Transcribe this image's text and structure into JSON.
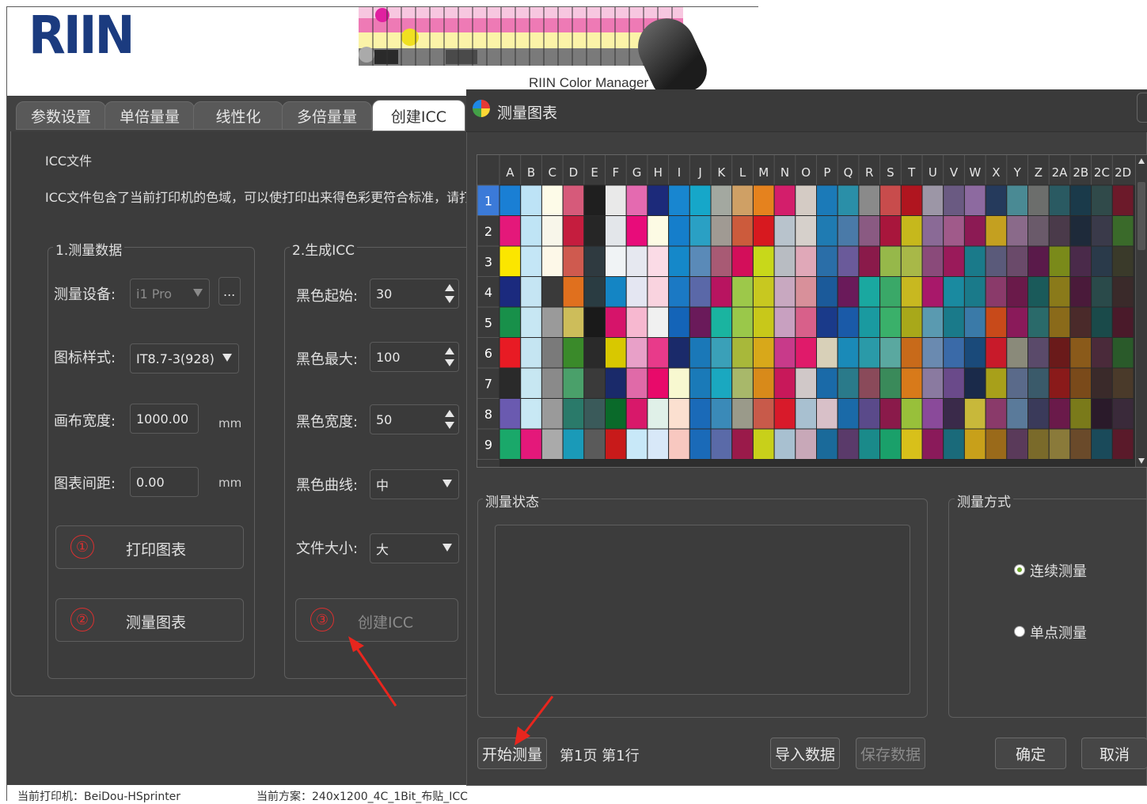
{
  "app": {
    "logo_text": "RIIN",
    "banner_caption": "RIIN Color Manager",
    "tabs": [
      "参数设置",
      "单倍量量",
      "线性化",
      "多倍量量",
      "创建ICC"
    ],
    "active_tab": "创建ICC"
  },
  "icc": {
    "section_title": "ICC文件",
    "description": "ICC文件包含了当前打印机的色域，可以使打印出来得色彩更符合标准，请打印图表",
    "group1": {
      "title": "1.测量数据",
      "device_label": "测量设备:",
      "device_value": "i1 Pro",
      "device_more": "...",
      "chart_style_label": "图标样式:",
      "chart_style_value": "IT8.7-3(928)",
      "canvas_width_label": "画布宽度:",
      "canvas_width_value": "1000.00",
      "chart_gap_label": "图表间距:",
      "chart_gap_value": "0.00",
      "unit_mm": "mm",
      "print_button": {
        "number": "①",
        "label": "打印图表"
      },
      "measure_button": {
        "number": "②",
        "label": "测量图表"
      }
    },
    "group2": {
      "title": "2.生成ICC",
      "black_start_label": "黑色起始:",
      "black_start_value": "30",
      "black_max_label": "黑色最大:",
      "black_max_value": "100",
      "black_width_label": "黑色宽度:",
      "black_width_value": "50",
      "black_curve_label": "黑色曲线:",
      "black_curve_value": "中",
      "file_size_label": "文件大小:",
      "file_size_value": "大",
      "create_button": {
        "number": "③",
        "label": "创建ICC"
      }
    }
  },
  "statusbar": {
    "printer": "当前打印机：BeiDou-HSprinter",
    "scheme": "当前方案：240x1200_4C_1Bit_布贴_ICC"
  },
  "dialog": {
    "title": "测量图表",
    "columns": [
      "A",
      "B",
      "C",
      "D",
      "E",
      "F",
      "G",
      "H",
      "I",
      "J",
      "K",
      "L",
      "M",
      "N",
      "O",
      "P",
      "Q",
      "R",
      "S",
      "T",
      "U",
      "V",
      "W",
      "X",
      "Y",
      "Z",
      "2A",
      "2B",
      "2C",
      "2D"
    ],
    "rows": [
      "1",
      "2",
      "3",
      "4",
      "5",
      "6",
      "7",
      "8",
      "9"
    ],
    "patch_colors": [
      [
        "#1a7fd4",
        "#bde3f6",
        "#fdfbe8",
        "#d65a7a",
        "#1f1f1f",
        "#e9e9e9",
        "#e46ab0",
        "#1c2a7a",
        "#1886d0",
        "#16a7c9",
        "#a3a8a0",
        "#cfa065",
        "#e5821e",
        "#d31e6b",
        "#d4cbc4",
        "#1b7ab8",
        "#2a8fa8",
        "#8a8a8a",
        "#c84c4c",
        "#b0151f",
        "#9c96a6",
        "#6a5a82",
        "#8d6aa0",
        "#253a5c",
        "#4a8a94",
        "#6c6e6c",
        "#2a5a62",
        "#1a3a4a",
        "#304a4a",
        "#6c1a2a"
      ],
      [
        "#e4187a",
        "#bfe4f5",
        "#f8f6ea",
        "#c51d3e",
        "#262626",
        "#e3e6ea",
        "#e80c7a",
        "#fdfbe4",
        "#157ecb",
        "#2aa0c4",
        "#a09a93",
        "#cc5b3c",
        "#d7191f",
        "#b8c3cc",
        "#d6d0cb",
        "#1f7bb2",
        "#4a7aa8",
        "#8a5a82",
        "#a8163c",
        "#c6b81c",
        "#8a6a96",
        "#a05a8a",
        "#8c1a54",
        "#c4a020",
        "#8a6a8a",
        "#6a5a6a",
        "#4a3a4a",
        "#1e2a3a",
        "#3a3a4a",
        "#3a6a2a"
      ],
      [
        "#fbe600",
        "#c4e6f6",
        "#fdf8e8",
        "#cf5a4f",
        "#2f3a40",
        "#f0f3f5",
        "#e6e8f0",
        "#fbdbe6",
        "#1588c9",
        "#5a8ab8",
        "#a85a74",
        "#d30e5a",
        "#c8d81a",
        "#b8bcc2",
        "#e0a8b8",
        "#2a6ea8",
        "#6a5a9a",
        "#8a1a4a",
        "#96b84a",
        "#a8b848",
        "#8a4a7a",
        "#9a1a5a",
        "#1a7a8a",
        "#5a5a7a",
        "#6a4a6a",
        "#5a1a4a",
        "#7a8a1a",
        "#4a2a4a",
        "#2a3a4a",
        "#3a3a2a"
      ],
      [
        "#1b2a7e",
        "#c5e5f3",
        "#3a3a3a",
        "#e0701e",
        "#2a3c42",
        "#1485c4",
        "#e4e6f2",
        "#f9d3df",
        "#1b79c4",
        "#5a68a8",
        "#b81460",
        "#9dc84a",
        "#c8c820",
        "#c8a8c0",
        "#d8909a",
        "#1b5a9a",
        "#6a1a5a",
        "#1aa8a0",
        "#3aa868",
        "#c8b820",
        "#a8186a",
        "#1a8aa0",
        "#1a7a8a",
        "#8a3a6a",
        "#6a1a4a",
        "#1a5a5a",
        "#8a7a1a",
        "#4a1a3a",
        "#2a4a4a",
        "#3a2a2a"
      ],
      [
        "#18904a",
        "#c7e7f3",
        "#9a9a9a",
        "#cdbd5a",
        "#1a1a1a",
        "#d6146a",
        "#f7b8d0",
        "#f0f0f0",
        "#1464b8",
        "#6a1a5a",
        "#1ab4a0",
        "#9ac84a",
        "#c8c81a",
        "#c8a0c0",
        "#d8608a",
        "#1a3a8a",
        "#1a5aa8",
        "#1a9aa0",
        "#3ab06a",
        "#a8a81a",
        "#5a9ab0",
        "#1a7a8a",
        "#3a7aa8",
        "#c84a1a",
        "#8a1a5a",
        "#2a6a6a",
        "#8a6a1a",
        "#4a2a2a",
        "#1a4a4a",
        "#4a1a2a"
      ],
      [
        "#e81b24",
        "#c5e5f2",
        "#7a7a7a",
        "#3a8a2a",
        "#2a2a2a",
        "#d8c800",
        "#e8a0c8",
        "#e83a8a",
        "#1a2a6a",
        "#1a78b8",
        "#3aa0b8",
        "#a8b83a",
        "#d8a81a",
        "#c83a8a",
        "#e01a6a",
        "#d8d0b8",
        "#1a8ab8",
        "#2a9aa8",
        "#5aa8a0",
        "#c86a1a",
        "#6a8ab0",
        "#3a6aa8",
        "#1a4a7a",
        "#c81a2a",
        "#8a8a7a",
        "#5a4a6a",
        "#6a1a1a",
        "#8a5a1a",
        "#4a2a3a",
        "#2a5a2a"
      ],
      [
        "#2a2a2a",
        "#c7e7f2",
        "#8a8a8a",
        "#4aa06a",
        "#3a3a3a",
        "#1a2a6a",
        "#e06aa8",
        "#e80a6a",
        "#f8f8d0",
        "#1a7ab8",
        "#1aa8c0",
        "#a8b86a",
        "#d88a1a",
        "#c8185a",
        "#d0c8c8",
        "#1a6aa8",
        "#2a7a8a",
        "#8a4a5a",
        "#3a8a5a",
        "#d87a1a",
        "#8a7aa0",
        "#6a4a8a",
        "#1a2a4a",
        "#a8a01a",
        "#5a6a8a",
        "#3a5a6a",
        "#8a1a1a",
        "#7a4a1a",
        "#3a2a2a",
        "#4a3a2a"
      ],
      [
        "#6a5ab0",
        "#c8e8f4",
        "#9a9a9a",
        "#2a7a6a",
        "#3a5a5a",
        "#0a6a2a",
        "#d8186a",
        "#e0f0e8",
        "#fbe0d0",
        "#1a6ab8",
        "#3a8ab8",
        "#9a9a8a",
        "#c85a4a",
        "#d81a2a",
        "#a8c0d0",
        "#d8c0c8",
        "#1a6aa8",
        "#5a4a8a",
        "#8a1a4a",
        "#98c03a",
        "#8a4a9a",
        "#3a2a4a",
        "#c8b83a",
        "#8a3a6a",
        "#5a7a9a",
        "#3a3a5a",
        "#6a1a4a",
        "#7a7a1a",
        "#2a1a2a",
        "#3a2a3a"
      ],
      [
        "#1aa86a",
        "#e4187a",
        "#aaaaaa",
        "#1a9ab8",
        "#5a5a5a",
        "#c81a1a",
        "#c8e8f8",
        "#d8e8f8",
        "#f8c8c0",
        "#1a6ab8",
        "#5a6aa8",
        "#9a1a4a",
        "#c8d01a",
        "#a8c0d0",
        "#c8a8b8",
        "#1a6a9a",
        "#5a3a6a",
        "#1a8a8a",
        "#1aa06a",
        "#d8c01a",
        "#8a1a5a",
        "#1a6a7a",
        "#c8a01a",
        "#9a6a1a",
        "#5a3a5a",
        "#7a6a2a",
        "#8a7a3a",
        "#6a4a2a",
        "#1a4a5a",
        "#5a1a2a"
      ]
    ],
    "status_group_title": "测量状态",
    "status_text": "",
    "mode_group_title": "测量方式",
    "mode_options": [
      {
        "label": "连续测量",
        "selected": true
      },
      {
        "label": "单点测量",
        "selected": false
      }
    ],
    "start_button": "开始测量",
    "position_text": "第1页 第1行",
    "import_button": "导入数据",
    "save_button": "保存数据",
    "ok_button": "确定",
    "cancel_button": "取消"
  }
}
